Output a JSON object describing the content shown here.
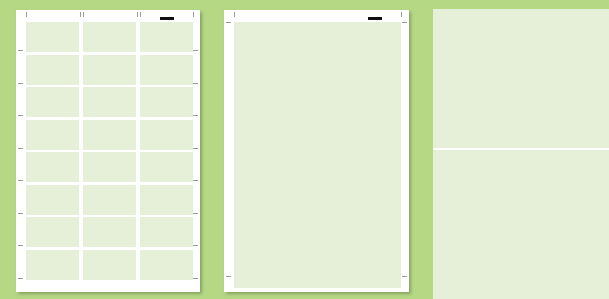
{
  "canvas": {
    "background": "#b5d884"
  },
  "sheets": [
    {
      "name": "label-sheet-3x8",
      "paper_color": "#ffffff",
      "label_color": "#e6f0d8",
      "columns": 3,
      "rows": 8
    },
    {
      "name": "label-sheet-full-page",
      "paper_color": "#ffffff",
      "label_color": "#e6f0d8"
    },
    {
      "name": "label-sheet-half-page",
      "label_color": "#e6f0d8"
    }
  ]
}
